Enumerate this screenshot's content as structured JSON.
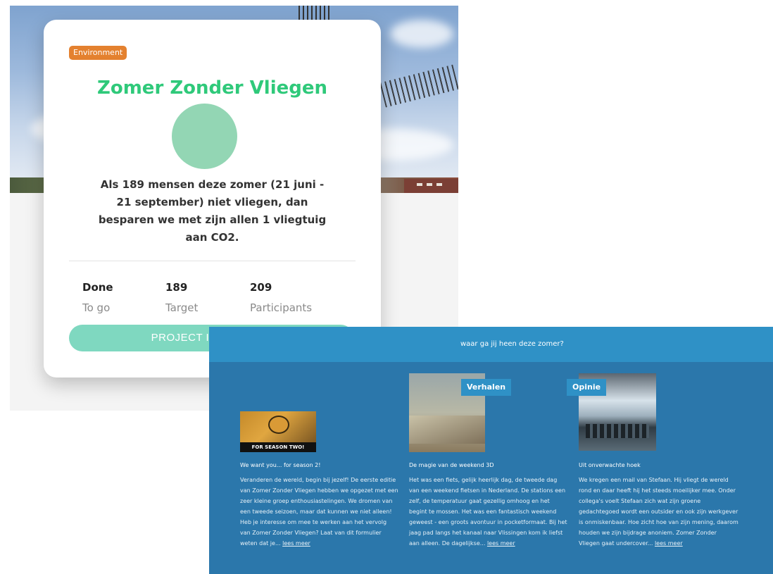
{
  "project_card": {
    "category_tag": "Environment",
    "title": "Zomer Zonder Vliegen",
    "description": "Als 189 mensen deze zomer (21 juni - 21 september) niet vliegen, dan besparen we met zijn allen 1 vliegtuig aan CO2.",
    "stats": [
      {
        "value": "Done",
        "label": "To go"
      },
      {
        "value": "189",
        "label": "Target"
      },
      {
        "value": "209",
        "label": "Participants"
      }
    ],
    "status_button": "PROJECT IS FINISHED",
    "colors": {
      "title": "#2fc97a",
      "tag": "#e4812f",
      "button": "#7fd8c0",
      "avatar": "#93d6b4"
    }
  },
  "blog_section": {
    "header_text": "waar ga jij heen deze zomer?",
    "posts": [
      {
        "category": "",
        "thumb_caption": "FOR SEASON TWO!",
        "title": "We want you... for season 2!",
        "text": "Veranderen de wereld, begin bij jezelf! De eerste editie van Zomer Zonder Vliegen hebben we opgezet met een zeer kleine groep enthousiastelingen. We dromen van een tweede seizoen, maar dat kunnen we niet alleen! Heb je interesse om mee te werken aan het vervolg van Zomer Zonder Vliegen? Laat van dit formulier weten dat je...",
        "more": "lees meer"
      },
      {
        "category": "Verhalen",
        "thumb_caption": "",
        "title": "De magie van de weekend 3D",
        "text": "Het was een fiets, gelijk heerlijk dag, de tweede dag van een weekend fietsen in Nederland. De stations een zelf, de temperatuur gaat gezellig omhoog en het begint te mossen. Het was een fantastisch weekend geweest - een groots avontuur in pocketformaat. Bij het jaag pad langs het kanaal naar Vlissingen kom ik liefst aan alleen. De dagelijkse...",
        "more": "lees meer"
      },
      {
        "category": "Opinie",
        "thumb_caption": "",
        "title": "Uit onverwachte hoek",
        "text": "We kregen een mail van Stefaan. Hij vliegt de wereld rond en daar heeft hij het steeds moeilijker mee. Onder collega's voelt Stefaan zich wat zijn groene gedachtegoed wordt een outsider en ook zijn werkgever is onmiskenbaar. Hoe zicht hoe van zijn mening, daarom houden we zijn bijdrage anoniem. Zomer Zonder Vliegen gaat undercover...",
        "more": "lees meer"
      }
    ],
    "colors": {
      "header": "#2f91c6",
      "background": "#2b77ab"
    }
  }
}
